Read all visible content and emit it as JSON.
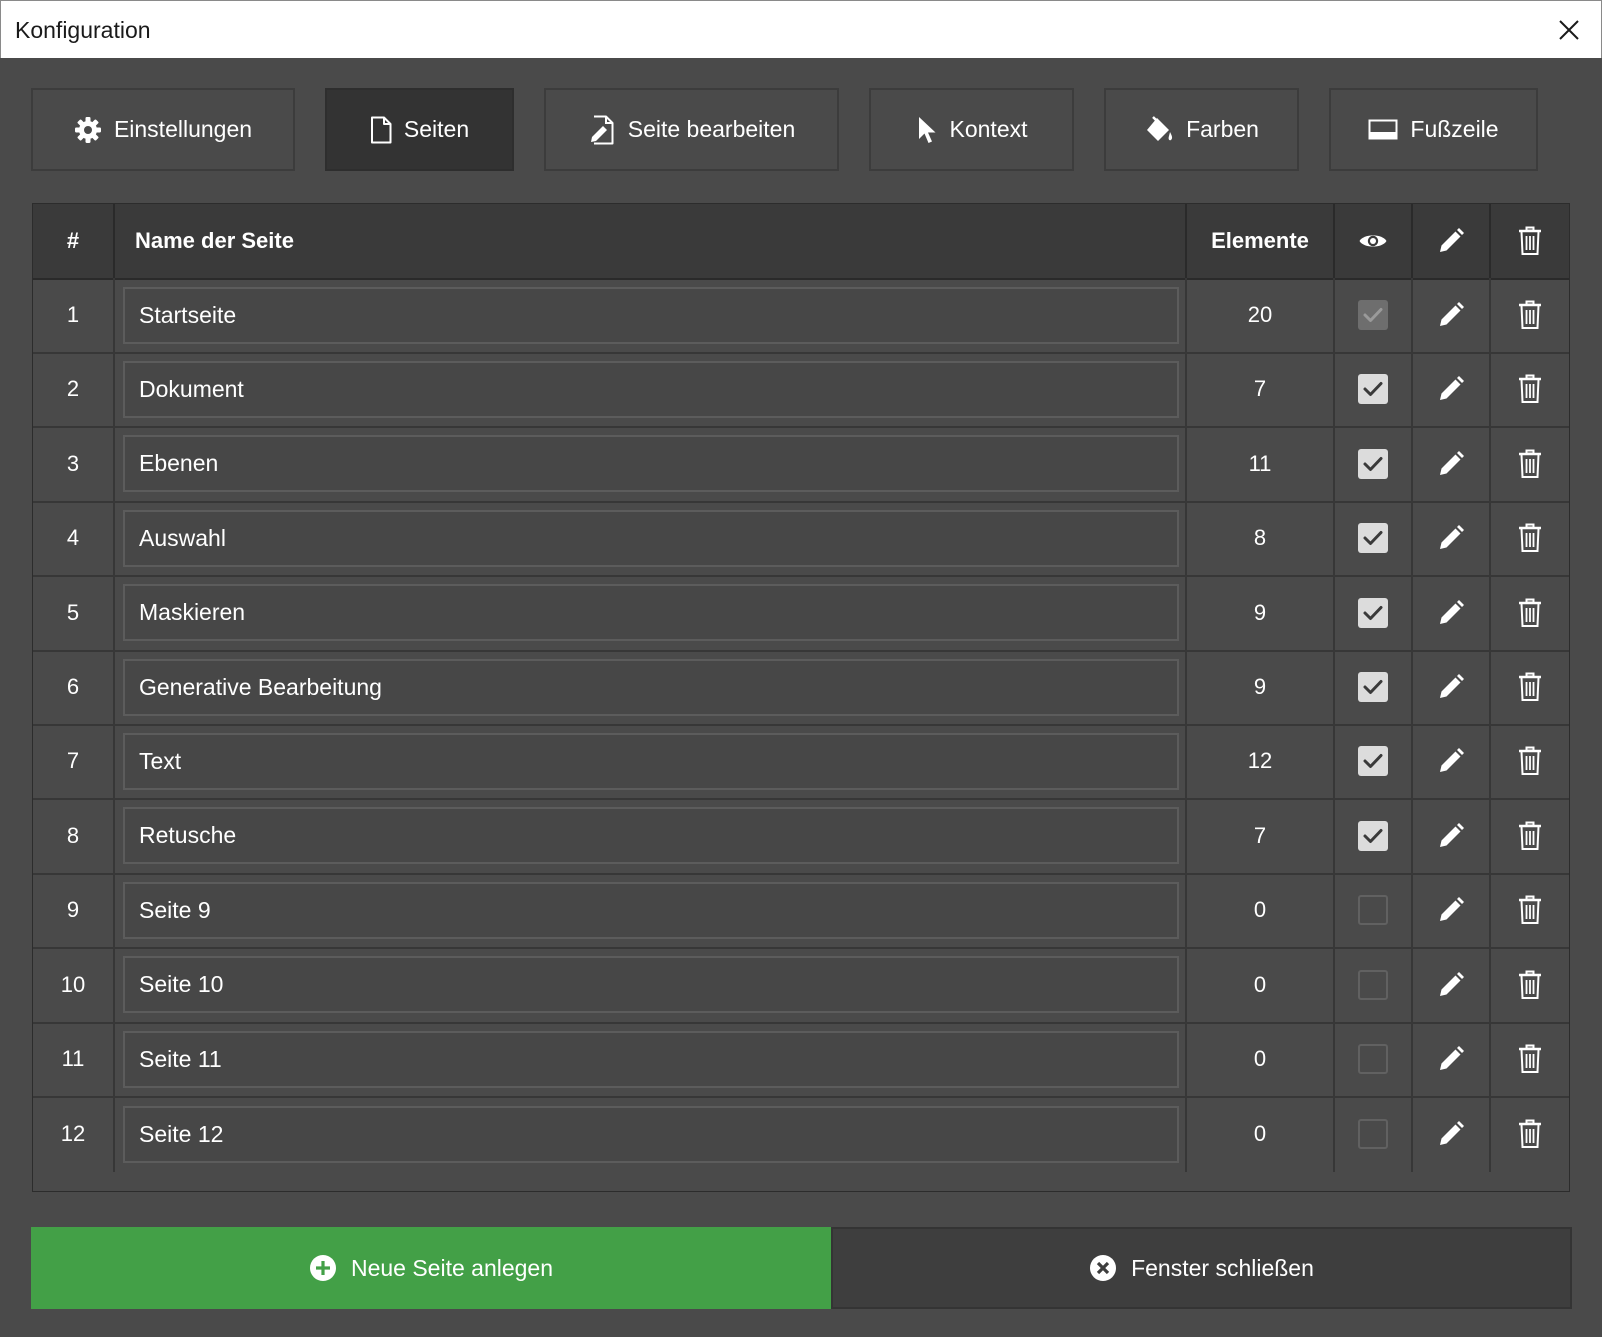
{
  "window": {
    "title": "Konfiguration",
    "close_icon": "close-icon"
  },
  "toolbar": {
    "active": "Seiten",
    "tabs": [
      {
        "id": "einstellungen",
        "label": "Einstellungen",
        "icon": "gear-icon"
      },
      {
        "id": "seiten",
        "label": "Seiten",
        "icon": "page-icon"
      },
      {
        "id": "seite-bearbeiten",
        "label": "Seite bearbeiten",
        "icon": "page-edit-icon"
      },
      {
        "id": "kontext",
        "label": "Kontext",
        "icon": "cursor-icon"
      },
      {
        "id": "farben",
        "label": "Farben",
        "icon": "paint-bucket-icon"
      },
      {
        "id": "fusszeile",
        "label": "Fußzeile",
        "icon": "footer-icon"
      }
    ]
  },
  "table": {
    "headers": {
      "number": "#",
      "name": "Name der Seite",
      "elements": "Elemente",
      "visible_icon": "eye-icon",
      "edit_icon": "pencil-icon",
      "delete_icon": "trash-icon"
    },
    "rows": [
      {
        "number": "1",
        "name": "Startseite",
        "elements": "20",
        "visible": true,
        "disabled": true
      },
      {
        "number": "2",
        "name": "Dokument",
        "elements": "7",
        "visible": true,
        "disabled": false
      },
      {
        "number": "3",
        "name": "Ebenen",
        "elements": "11",
        "visible": true,
        "disabled": false
      },
      {
        "number": "4",
        "name": "Auswahl",
        "elements": "8",
        "visible": true,
        "disabled": false
      },
      {
        "number": "5",
        "name": "Maskieren",
        "elements": "9",
        "visible": true,
        "disabled": false
      },
      {
        "number": "6",
        "name": "Generative Bearbeitung",
        "elements": "9",
        "visible": true,
        "disabled": false
      },
      {
        "number": "7",
        "name": "Text",
        "elements": "12",
        "visible": true,
        "disabled": false
      },
      {
        "number": "8",
        "name": "Retusche",
        "elements": "7",
        "visible": true,
        "disabled": false
      },
      {
        "number": "9",
        "name": "Seite 9",
        "elements": "0",
        "visible": false,
        "disabled": false
      },
      {
        "number": "10",
        "name": "Seite 10",
        "elements": "0",
        "visible": false,
        "disabled": false
      },
      {
        "number": "11",
        "name": "Seite 11",
        "elements": "0",
        "visible": false,
        "disabled": false
      },
      {
        "number": "12",
        "name": "Seite 12",
        "elements": "0",
        "visible": false,
        "disabled": false
      }
    ]
  },
  "footer": {
    "new_page_label": "Neue Seite anlegen",
    "new_page_icon": "plus-circle-icon",
    "close_label": "Fenster schließen",
    "close_icon": "x-circle-icon"
  },
  "colors": {
    "background": "#4a4a4a",
    "header_background": "#3a3a3a",
    "active_tab": "#333333",
    "primary_green": "#43a047",
    "titlebar": "#ffffff"
  }
}
